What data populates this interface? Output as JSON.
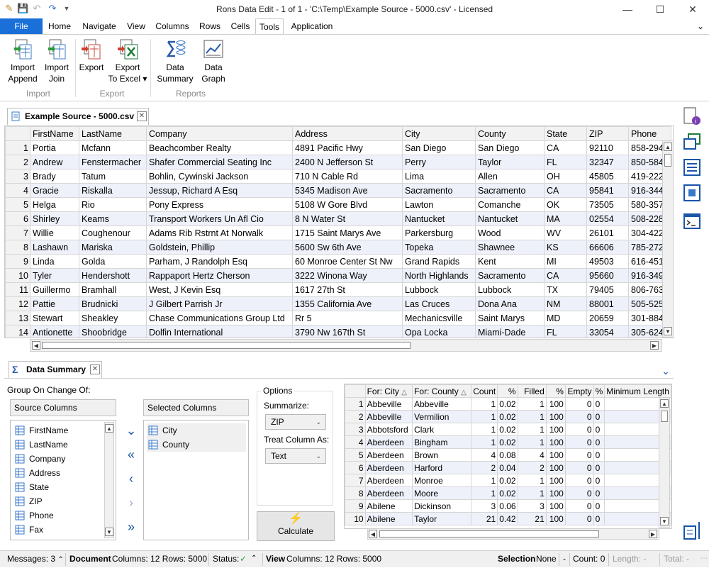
{
  "window": {
    "title": "Rons Data Edit - 1 of 1 - 'C:\\Temp\\Example Source - 5000.csv' - Licensed"
  },
  "menu": {
    "file": "File",
    "tabs": [
      "Home",
      "Navigate",
      "View",
      "Columns",
      "Rows",
      "Cells",
      "Tools",
      "Application"
    ],
    "active_tab": "Tools"
  },
  "ribbon": {
    "import": {
      "group": "Import",
      "append_line1": "Import",
      "append_line2": "Append",
      "join_line1": "Import",
      "join_line2": "Join"
    },
    "export": {
      "group": "Export",
      "export_label": "Export",
      "excel_line1": "Export",
      "excel_line2": "To Excel ▾"
    },
    "reports": {
      "group": "Reports",
      "summary_line1": "Data",
      "summary_line2": "Summary",
      "graph_line1": "Data",
      "graph_line2": "Graph"
    }
  },
  "document": {
    "tab_label": "Example Source - 5000.csv",
    "columns": [
      "FirstName",
      "LastName",
      "Company",
      "Address",
      "City",
      "County",
      "State",
      "ZIP",
      "Phone"
    ],
    "rows": [
      [
        "1",
        "Portia",
        "Mcfann",
        "Beachcomber Realty",
        "4891 Pacific Hwy",
        "San Diego",
        "San Diego",
        "CA",
        "92110",
        "858-294"
      ],
      [
        "2",
        "Andrew",
        "Fenstermacher",
        "Shafer Commercial Seating Inc",
        "2400 N Jefferson St",
        "Perry",
        "Taylor",
        "FL",
        "32347",
        "850-584"
      ],
      [
        "3",
        "Brady",
        "Tatum",
        "Bohlin, Cywinski Jackson",
        "710 N Cable Rd",
        "Lima",
        "Allen",
        "OH",
        "45805",
        "419-222"
      ],
      [
        "4",
        "Gracie",
        "Riskalla",
        "Jessup, Richard A Esq",
        "5345 Madison Ave",
        "Sacramento",
        "Sacramento",
        "CA",
        "95841",
        "916-344"
      ],
      [
        "5",
        "Helga",
        "Rio",
        "Pony Express",
        "5108 W Gore Blvd",
        "Lawton",
        "Comanche",
        "OK",
        "73505",
        "580-357"
      ],
      [
        "6",
        "Shirley",
        "Keams",
        "Transport Workers Un Afl Cio",
        "8 N Water St",
        "Nantucket",
        "Nantucket",
        "MA",
        "02554",
        "508-228"
      ],
      [
        "7",
        "Willie",
        "Coughenour",
        "Adams Rib Rstrnt At Norwalk",
        "1715 Saint Marys Ave",
        "Parkersburg",
        "Wood",
        "WV",
        "26101",
        "304-422"
      ],
      [
        "8",
        "Lashawn",
        "Mariska",
        "Goldstein, Phillip",
        "5600 Sw 6th Ave",
        "Topeka",
        "Shawnee",
        "KS",
        "66606",
        "785-272"
      ],
      [
        "9",
        "Linda",
        "Golda",
        "Parham, J Randolph Esq",
        "60 Monroe Center St Nw",
        "Grand Rapids",
        "Kent",
        "MI",
        "49503",
        "616-451"
      ],
      [
        "10",
        "Tyler",
        "Hendershott",
        "Rappaport Hertz Cherson",
        "3222 Winona Way",
        "North Highlands",
        "Sacramento",
        "CA",
        "95660",
        "916-349"
      ],
      [
        "11",
        "Guillermo",
        "Bramhall",
        "West, J Kevin Esq",
        "1617 27th St",
        "Lubbock",
        "Lubbock",
        "TX",
        "79405",
        "806-763"
      ],
      [
        "12",
        "Pattie",
        "Brudnicki",
        "J Gilbert Parrish Jr",
        "1355 California Ave",
        "Las Cruces",
        "Dona Ana",
        "NM",
        "88001",
        "505-525"
      ],
      [
        "13",
        "Stewart",
        "Sheakley",
        "Chase Communications Group Ltd",
        "Rr 5",
        "Mechanicsville",
        "Saint Marys",
        "MD",
        "20659",
        "301-884"
      ],
      [
        "14",
        "Antionette",
        "Shoobridge",
        "Dolfin International",
        "3790 Nw 167th St",
        "Opa Locka",
        "Miami-Dade",
        "FL",
        "33054",
        "305-624"
      ]
    ]
  },
  "summary": {
    "tab_label": "Data Summary",
    "group_label": "Group On Change Of:",
    "source_header": "Source Columns",
    "selected_header": "Selected Columns",
    "source_columns": [
      "FirstName",
      "LastName",
      "Company",
      "Address",
      "State",
      "ZIP",
      "Phone",
      "Fax"
    ],
    "selected_columns": [
      "City",
      "County"
    ],
    "options": {
      "title": "Options",
      "summarize_label": "Summarize:",
      "summarize_value": "ZIP",
      "treat_label": "Treat Column As:",
      "treat_value": "Text",
      "calculate": "Calculate"
    },
    "grid_headers": [
      "For: City",
      "For: County",
      "Count",
      "%",
      "Filled",
      "%",
      "Empty",
      "%",
      "Minimum Length"
    ],
    "grid_rows": [
      [
        "1",
        "Abbeville",
        "Abbeville",
        "1",
        "0.02",
        "1",
        "100",
        "0",
        "0",
        ""
      ],
      [
        "2",
        "Abbeville",
        "Vermilion",
        "1",
        "0.02",
        "1",
        "100",
        "0",
        "0",
        ""
      ],
      [
        "3",
        "Abbotsford",
        "Clark",
        "1",
        "0.02",
        "1",
        "100",
        "0",
        "0",
        ""
      ],
      [
        "4",
        "Aberdeen",
        "Bingham",
        "1",
        "0.02",
        "1",
        "100",
        "0",
        "0",
        ""
      ],
      [
        "5",
        "Aberdeen",
        "Brown",
        "4",
        "0.08",
        "4",
        "100",
        "0",
        "0",
        ""
      ],
      [
        "6",
        "Aberdeen",
        "Harford",
        "2",
        "0.04",
        "2",
        "100",
        "0",
        "0",
        ""
      ],
      [
        "7",
        "Aberdeen",
        "Monroe",
        "1",
        "0.02",
        "1",
        "100",
        "0",
        "0",
        ""
      ],
      [
        "8",
        "Aberdeen",
        "Moore",
        "1",
        "0.02",
        "1",
        "100",
        "0",
        "0",
        ""
      ],
      [
        "9",
        "Abilene",
        "Dickinson",
        "3",
        "0.06",
        "3",
        "100",
        "0",
        "0",
        ""
      ],
      [
        "10",
        "Abilene",
        "Taylor",
        "21",
        "0.42",
        "21",
        "100",
        "0",
        "0",
        ""
      ]
    ]
  },
  "status": {
    "messages": "Messages: 3",
    "document": "Document",
    "doc_counts": "Columns: 12 Rows: 5000",
    "status_label": "Status:",
    "view": "View",
    "view_counts": "Columns: 12 Rows: 5000",
    "selection": "Selection",
    "selection_value": "None",
    "dash": "-",
    "count": "Count: 0",
    "length": "Length: -",
    "total": "Total: -"
  },
  "colors": {
    "accent": "#1a6fd8",
    "alt_row": "#eef1fa",
    "header_bg": "#f2f2f2"
  }
}
